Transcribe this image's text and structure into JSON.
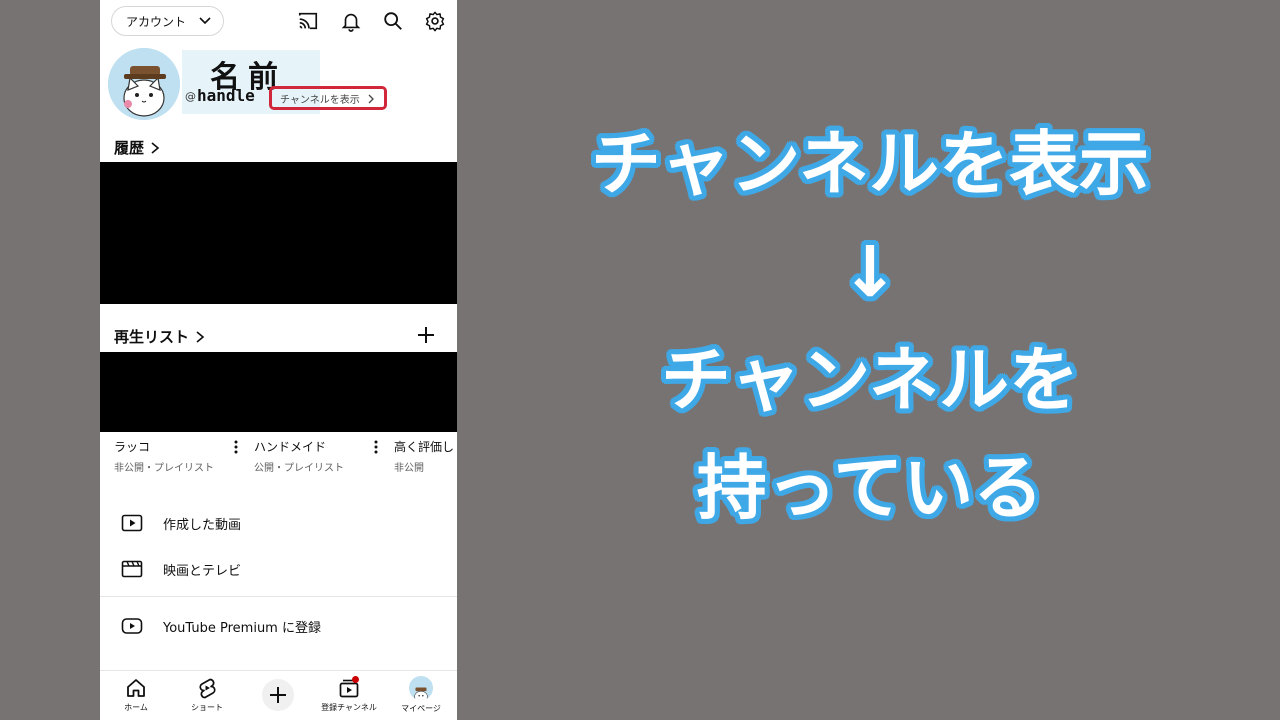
{
  "topbar": {
    "account_label": "アカウント",
    "icons": [
      "cast-icon",
      "bell-icon",
      "search-icon",
      "gear-icon"
    ]
  },
  "profile": {
    "name": "名前",
    "at": "@",
    "handle": "handle",
    "view_channel": "チャンネルを表示"
  },
  "history": {
    "title": "履歴"
  },
  "playlists": {
    "title": "再生リスト",
    "items": [
      {
        "title": "ラッコ",
        "subtitle": "非公開・プレイリスト"
      },
      {
        "title": "ハンドメイド",
        "subtitle": "公開・プレイリスト"
      },
      {
        "title": "高く評価し",
        "subtitle": "非公開"
      }
    ]
  },
  "menu": {
    "created_videos": "作成した動画",
    "movies_tv": "映画とテレビ",
    "premium": "YouTube Premium に登録"
  },
  "bottom_nav": {
    "home": "ホーム",
    "shorts": "ショート",
    "subscriptions": "登録チャンネル",
    "mypage": "マイページ"
  },
  "caption": {
    "line1": "チャンネルを表示",
    "line2": "↓",
    "line3": "チャンネルを",
    "line4": "持っている"
  },
  "colors": {
    "background": "#787373",
    "highlight_border": "#d0283a",
    "caption_outline": "#3fa8e6",
    "notification": "#cc0000"
  }
}
